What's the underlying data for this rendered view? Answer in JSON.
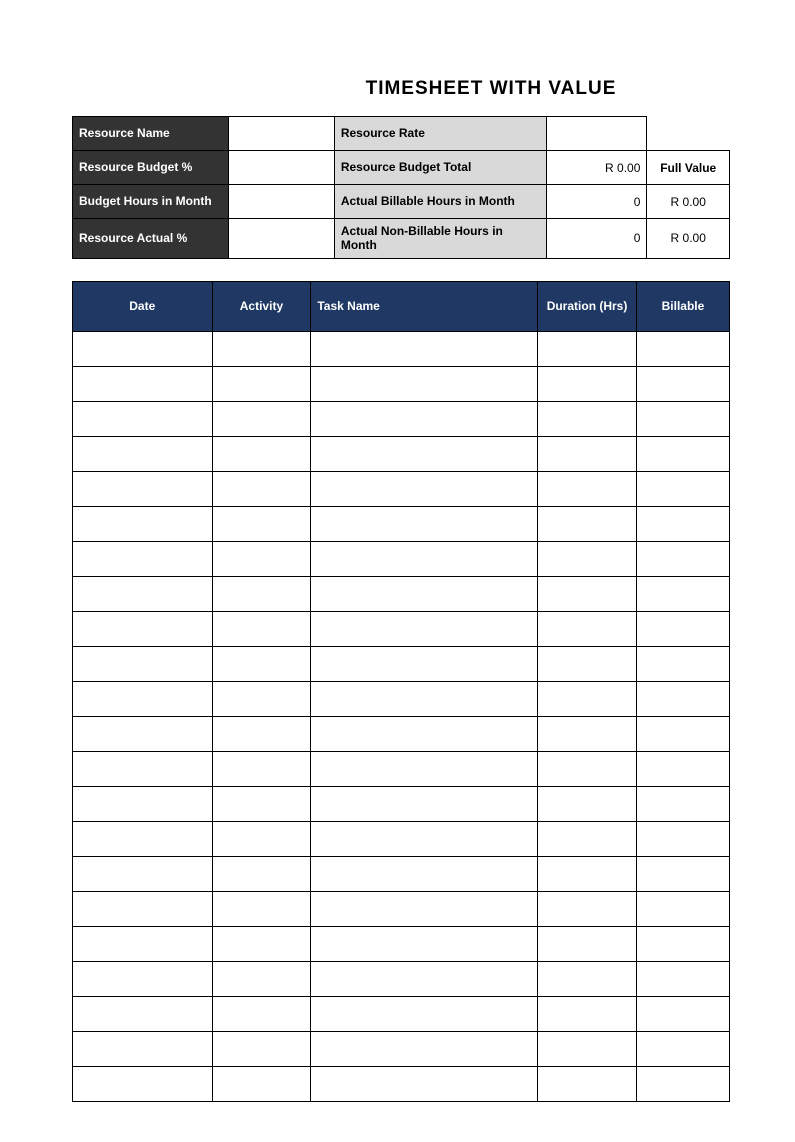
{
  "title": "TIMESHEET WITH VALUE",
  "info": {
    "row1_left": "Resource Name",
    "row1_mid": "Resource Rate",
    "row2_left": "Resource Budget %",
    "row2_mid": "Resource Budget Total",
    "row2_val": "R 0.00",
    "row2_side": "Full Value",
    "row3_left": "Budget Hours in Month",
    "row3_mid": "Actual Billable Hours in Month",
    "row3_val": "0",
    "row3_side": "R 0.00",
    "row4_left": "Resource Actual %",
    "row4_mid": "Actual Non-Billable Hours in Month",
    "row4_val": "0",
    "row4_side": "R 0.00"
  },
  "columns": {
    "date": "Date",
    "activity": "Activity",
    "task": "Task Name",
    "duration": "Duration (Hrs)",
    "billable": "Billable"
  },
  "row_count": 22
}
